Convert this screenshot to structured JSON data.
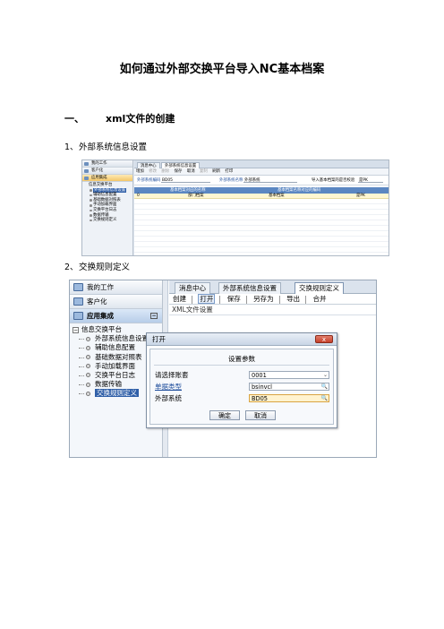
{
  "doc": {
    "title": "如何通过外部交换平台导入NC基本档案",
    "section1_num": "一、",
    "section1_title": "xml文件的创建",
    "sub1_num": "1、",
    "sub1_title": "外部系统信息设置",
    "sub2_num": "2、",
    "sub2_title": "交换规则定义"
  },
  "shot1": {
    "nav": [
      "我的工作",
      "客户化",
      "应用集成"
    ],
    "tree_root": "信息交换平台",
    "tree_items": [
      "外部系统信息设置",
      "辅助信息配置",
      "基础数据对照表",
      "手动加载界面",
      "交换平台日志",
      "数据传输",
      "交换规则定义"
    ],
    "tabs": [
      "消息中心",
      "外部系统信息设置"
    ],
    "toolbar": [
      "增加",
      "修改",
      "删除",
      "保存",
      "取消",
      "复制",
      "刷新",
      "打印"
    ],
    "form": {
      "code_label": "外部系统编码",
      "code_value": "BD05",
      "name_label": "外部系统名称",
      "name_value": "外部系统",
      "check_label": "导入基本档案的是否校验",
      "check_value": "是PK"
    },
    "grid_headers": [
      "基本档案对应的名称",
      "基本档案名称对应的编码"
    ],
    "grid_row": [
      "0",
      "部门档案",
      "基本档案",
      "是PK"
    ]
  },
  "shot2": {
    "nav": {
      "my_work": "我的工作",
      "customize": "客户化",
      "app_integration": "应用集成",
      "collapse": "−"
    },
    "tree": {
      "root_expander": "−",
      "root": "信息交换平台",
      "items": [
        "外部系统信息设置",
        "辅助信息配置",
        "基础数据对照表",
        "手动加载界面",
        "交换平台日志",
        "数据传输",
        "交换规则定义"
      ]
    },
    "tabs": [
      "消息中心",
      "外部系统信息设置",
      "交换规则定义"
    ],
    "toolbar": [
      "创建",
      "打开",
      "保存",
      "另存为",
      "导出",
      "合并"
    ],
    "xml_label": "XML文件设置",
    "dialog": {
      "title": "打开",
      "close": "x",
      "header": "设置参数",
      "rows": [
        {
          "label": "请选择账套",
          "value": "0001",
          "btn": "⌄"
        },
        {
          "label": "单据类型",
          "value": "bsinvcl",
          "btn": "🔍"
        },
        {
          "label": "外部系统",
          "value": "BD05",
          "btn": "🔍"
        }
      ],
      "ok": "确定",
      "cancel": "取消"
    }
  }
}
